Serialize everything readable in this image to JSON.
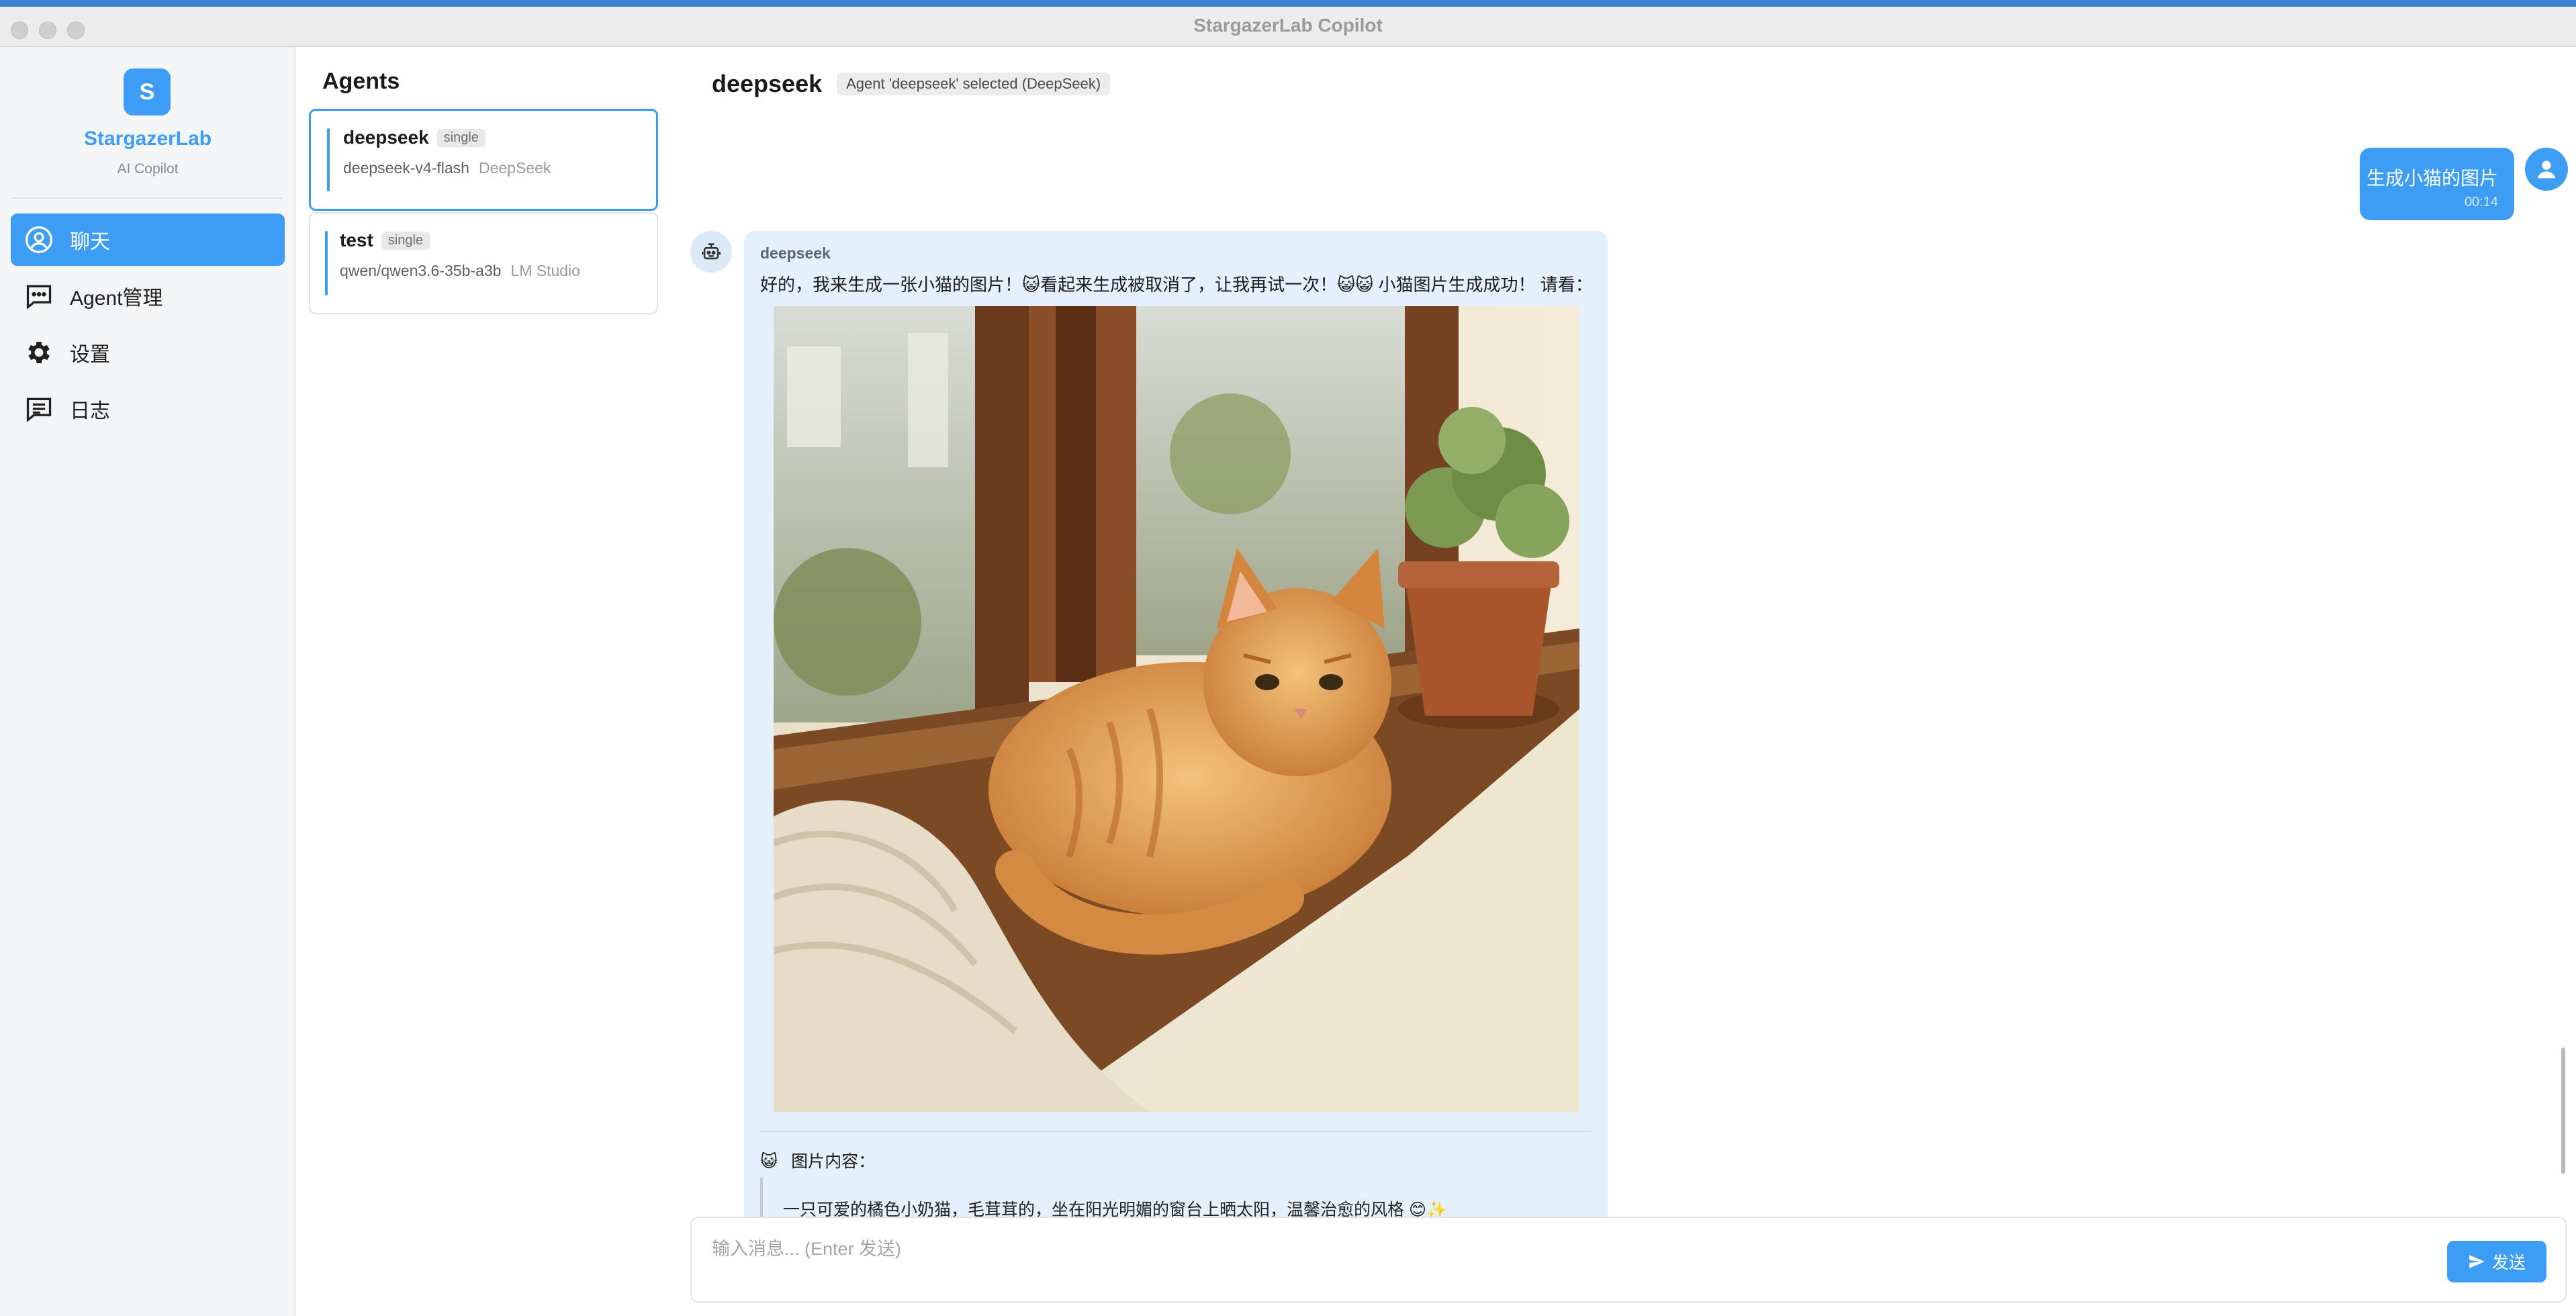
{
  "window": {
    "title": "StargazerLab Copilot"
  },
  "brand": {
    "logo_letter": "S",
    "name": "StargazerLab",
    "subtitle": "AI Copilot",
    "accent": "#3d9df5"
  },
  "sidebar": {
    "items": [
      {
        "label": "聊天",
        "icon": "chat-person-icon",
        "active": true
      },
      {
        "label": "Agent管理",
        "icon": "message-square-icon",
        "active": false
      },
      {
        "label": "设置",
        "icon": "gear-icon",
        "active": false
      },
      {
        "label": "日志",
        "icon": "log-message-icon",
        "active": false
      }
    ]
  },
  "agents": {
    "title": "Agents",
    "list": [
      {
        "name": "deepseek",
        "tag": "single",
        "model": "deepseek-v4-flash",
        "provider": "DeepSeek",
        "selected": true
      },
      {
        "name": "test",
        "tag": "single",
        "model": "qwen/qwen3.6-35b-a3b",
        "provider": "LM Studio",
        "selected": false
      }
    ]
  },
  "chat": {
    "title": "deepseek",
    "status": "Agent 'deepseek' selected (DeepSeek)",
    "messages": [
      {
        "role": "user",
        "text": "生成小猫的图片",
        "time": "00:14"
      },
      {
        "role": "assistant",
        "sender": "deepseek",
        "text": "好的，我来生成一张小猫的图片！😺看起来生成被取消了，让我再试一次！😺😺   小猫图片生成成功！ 请看：",
        "image_desc_icon": "cat-emoji-icon",
        "content_heading": "图片内容：",
        "content_heading_emoji": "😺",
        "quote": "一只可爱的橘色小奶猫，毛茸茸的，坐在阳光明媚的窗台上晒太阳，温馨治愈的风格 😊✨"
      }
    ]
  },
  "composer": {
    "placeholder": "输入消息... (Enter 发送)",
    "value": "",
    "send_label": "发送"
  }
}
